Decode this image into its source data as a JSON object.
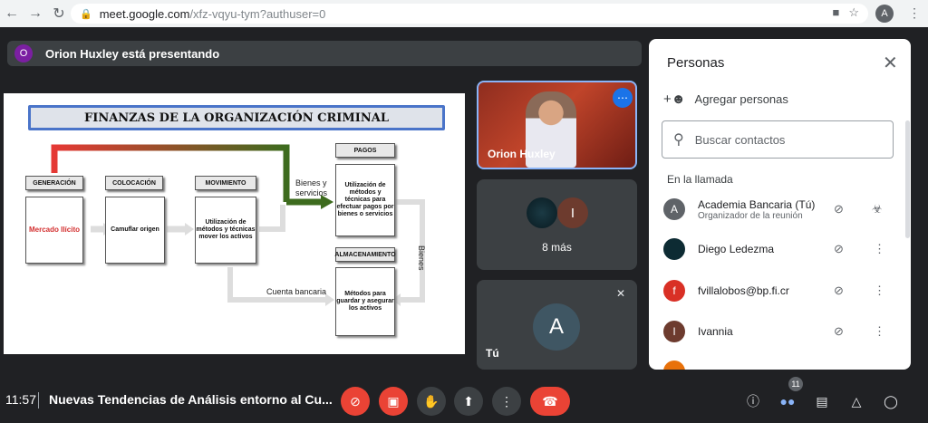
{
  "browser": {
    "url_host": "meet.google.com",
    "url_path": "/xfz-vqyu-tym?authuser=0",
    "profile_initial": "A"
  },
  "presenter": {
    "initial": "O",
    "text": "Orion Huxley está presentando"
  },
  "slide": {
    "title": "FINANZAS DE LA ORGANIZACIÓN CRIMINAL",
    "headers": {
      "generacion": "GENERACIÓN",
      "colocacion": "COLOCACIÓN",
      "movimiento": "MOVIMIENTO",
      "pagos": "PAGOS",
      "almacenamiento": "ALMACENAMIENTO"
    },
    "boxes": {
      "generacion": "Mercado Ilícito",
      "colocacion": "Camuflar origen",
      "movimiento": "Utilización de métodos y técnicas mover los activos",
      "pagos": "Utilización de métodos y técnicas para efectuar pagos por bienes o servicios",
      "almacenamiento": "Métodos para guardar y asegurar los activos"
    },
    "labels": {
      "bienes_servicios": "Bienes y servicios",
      "cuenta_bancaria": "Cuenta bancaria",
      "bienes": "Bienes"
    }
  },
  "tiles": {
    "presenter_name": "Orion Huxley",
    "more_initial": "I",
    "more_text": "8 más",
    "self_initial": "A",
    "self_label": "Tú"
  },
  "panel": {
    "title": "Personas",
    "add_label": "Agregar personas",
    "search_placeholder": "Buscar contactos",
    "section": "En la llamada",
    "people": [
      {
        "initial": "A",
        "name": "Academia Bancaria (Tú)",
        "sub": "Organizador de la reunión",
        "color": "#5f6368"
      },
      {
        "initial": "",
        "name": "Diego Ledezma",
        "sub": "",
        "color": "#0d2b33"
      },
      {
        "initial": "f",
        "name": "fvillalobos@bp.fi.cr",
        "sub": "",
        "color": "#d93025"
      },
      {
        "initial": "I",
        "name": "Ivannia",
        "sub": "",
        "color": "#6d3b2e"
      }
    ]
  },
  "bottom": {
    "time": "11:57",
    "meeting_title": "Nuevas Tendencias de Análisis entorno al Cu...",
    "people_count": "11"
  },
  "colors": {
    "red": "#ea4335",
    "dark": "#3c4043",
    "accent": "#8ab4f8"
  }
}
